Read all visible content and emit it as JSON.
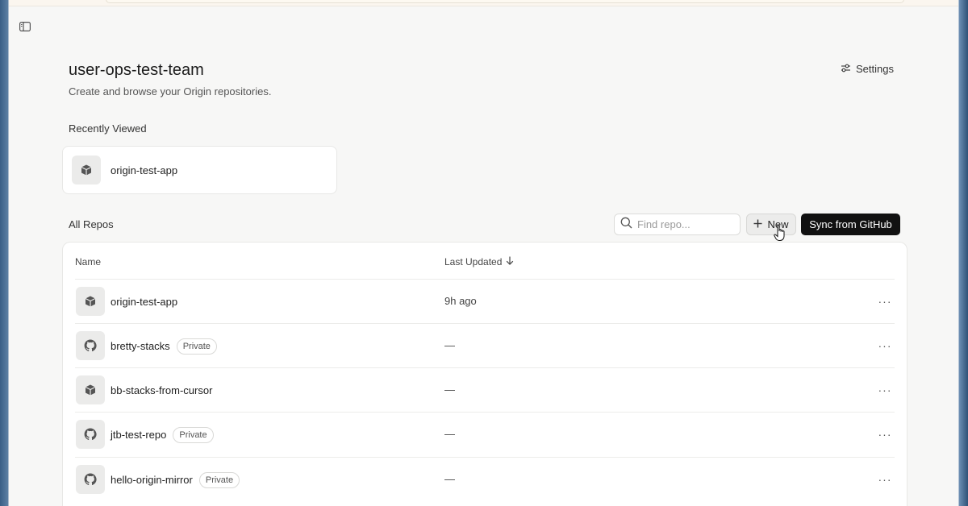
{
  "team": {
    "title": "user-ops-test-team",
    "subtitle": "Create and browse your Origin repositories."
  },
  "header": {
    "settings_label": "Settings"
  },
  "recent": {
    "label": "Recently Viewed",
    "items": [
      {
        "name": "origin-test-app",
        "icon": "cube-icon"
      }
    ]
  },
  "repos": {
    "label": "All Repos",
    "search_placeholder": "Find repo...",
    "new_label": "New",
    "sync_label": "Sync from GitHub",
    "columns": {
      "name": "Name",
      "updated": "Last Updated"
    },
    "rows": [
      {
        "name": "origin-test-app",
        "badge": "",
        "updated": "9h ago",
        "icon": "cube-icon"
      },
      {
        "name": "bretty-stacks",
        "badge": "Private",
        "updated": "—",
        "icon": "github-icon"
      },
      {
        "name": "bb-stacks-from-cursor",
        "badge": "",
        "updated": "—",
        "icon": "cube-icon"
      },
      {
        "name": "jtb-test-repo",
        "badge": "Private",
        "updated": "—",
        "icon": "github-icon"
      },
      {
        "name": "hello-origin-mirror",
        "badge": "Private",
        "updated": "—",
        "icon": "github-icon"
      }
    ],
    "more_label": "···"
  }
}
